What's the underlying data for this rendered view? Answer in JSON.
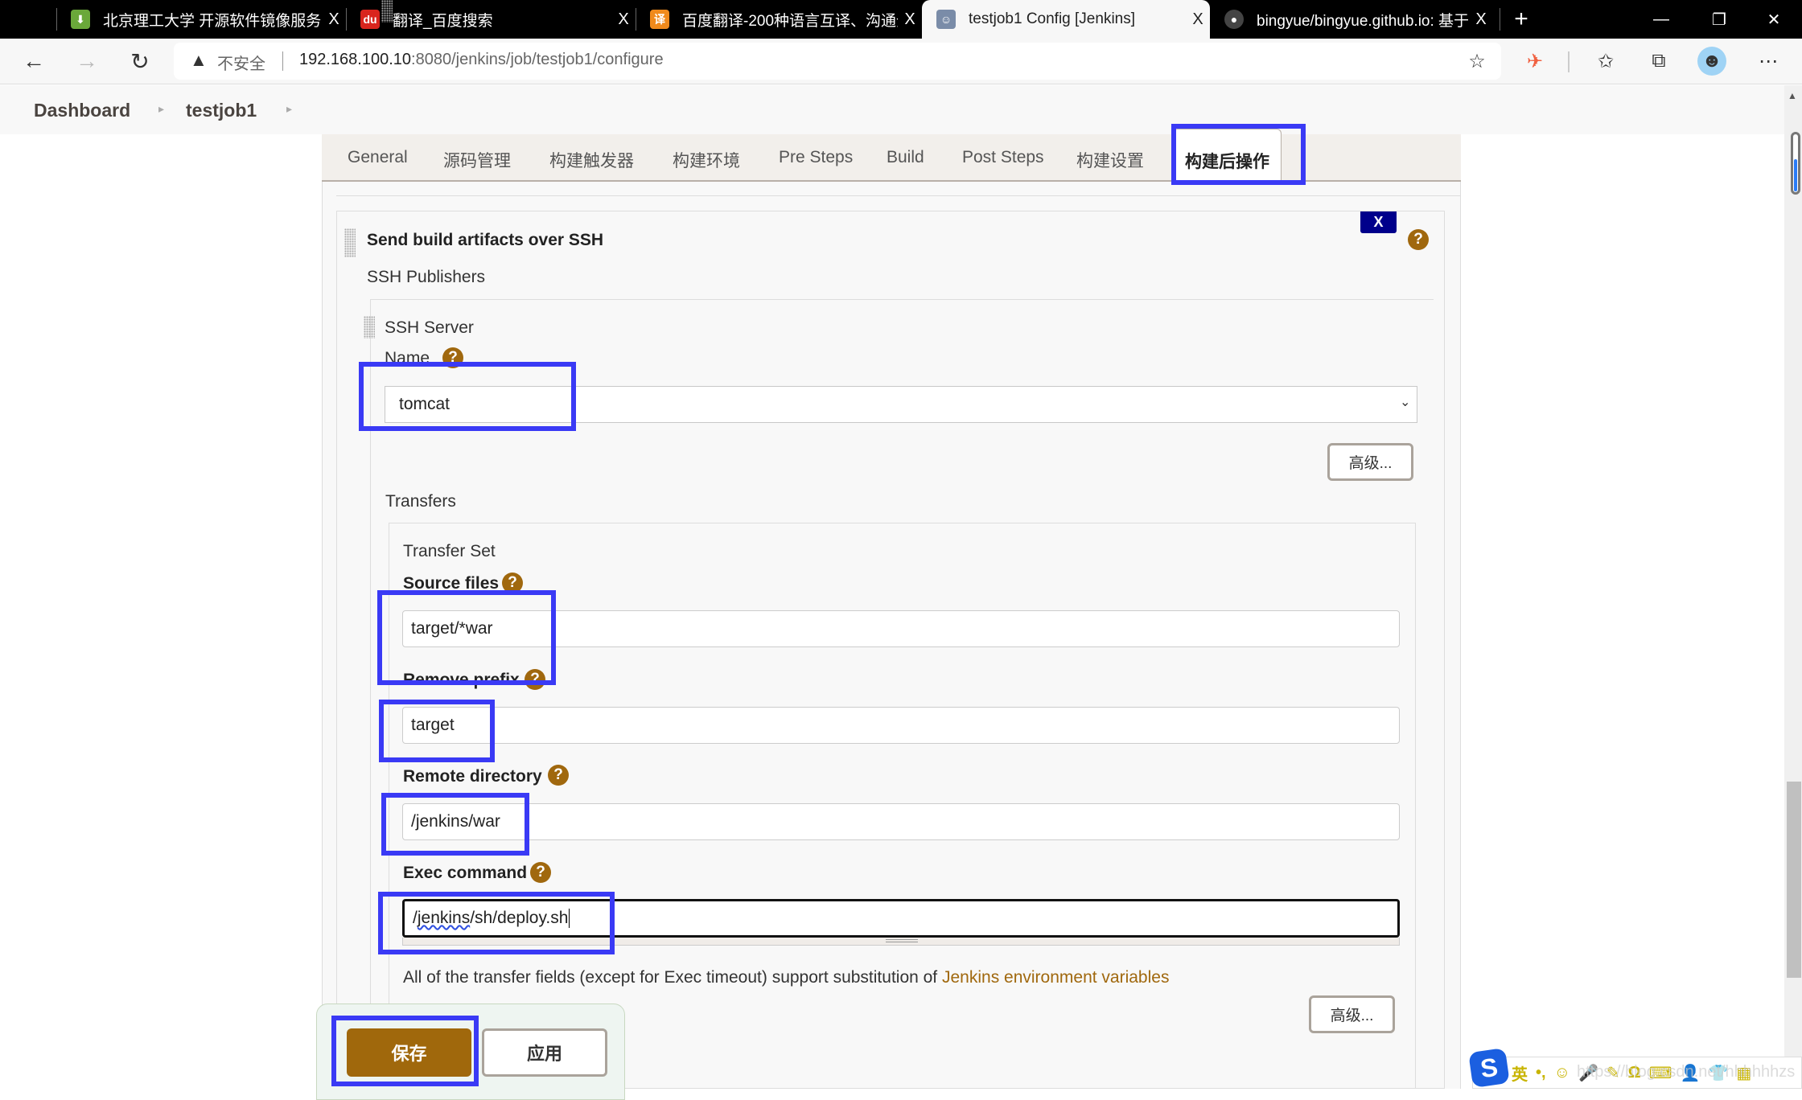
{
  "browser": {
    "tabs": [
      {
        "title": "北京理工大学 开源软件镜像服务",
        "favicon": "bit-mirror-icon",
        "color": "#6aa83a",
        "active": false
      },
      {
        "title": "翻译_百度搜索",
        "favicon": "baidu-paw-icon",
        "color": "#d9251d",
        "active": false
      },
      {
        "title": "百度翻译-200种语言互译、沟通全",
        "favicon": "baidu-translate-icon",
        "color": "#f08a1c",
        "active": false
      },
      {
        "title": "testjob1 Config [Jenkins]",
        "favicon": "jenkins-icon",
        "color": "#7a8ca8",
        "active": true
      },
      {
        "title": "bingyue/bingyue.github.io: 基于",
        "favicon": "github-icon",
        "color": "#444444",
        "active": false
      }
    ],
    "new_tab": "+",
    "close_glyph": "X",
    "window_controls": {
      "minimize": "—",
      "restore": "❐",
      "close": "✕"
    },
    "address": {
      "security_label": "不安全",
      "url_host": "192.168.100.10",
      "url_rest": ":8080/jenkins/job/testjob1/configure"
    }
  },
  "breadcrumb": [
    {
      "label": "Dashboard"
    },
    {
      "label": "testjob1"
    }
  ],
  "config_tabs": [
    {
      "label": "General"
    },
    {
      "label": "源码管理"
    },
    {
      "label": "构建触发器"
    },
    {
      "label": "构建环境"
    },
    {
      "label": "Pre Steps"
    },
    {
      "label": "Build"
    },
    {
      "label": "Post Steps"
    },
    {
      "label": "构建设置"
    },
    {
      "label": "构建后操作",
      "active": true
    }
  ],
  "section": {
    "title": "构建后操作",
    "publisher_title": "Send build artifacts over SSH",
    "delete_label": "X",
    "ssh_publishers_label": "SSH Publishers",
    "ssh_server_label": "SSH Server",
    "name_label": "Name",
    "name_value": "tomcat",
    "advanced_label": "高级...",
    "transfers_label": "Transfers",
    "transfer_set_label": "Transfer Set",
    "fields": {
      "source_files": {
        "label": "Source files",
        "value": "target/*war"
      },
      "remove_prefix": {
        "label": "Remove prefix",
        "value": "target"
      },
      "remote_directory": {
        "label": "Remote directory",
        "value": "/jenkins/war"
      },
      "exec_command": {
        "label": "Exec command",
        "value_underlined": "jenkins",
        "value_prefix": "/",
        "value_suffix": "/sh/deploy.sh"
      }
    },
    "env_note": "All of the transfer fields (except for Exec timeout) support substitution of ",
    "env_link": "Jenkins environment variables",
    "advanced2_label": "高级...",
    "help_glyph": "?"
  },
  "footer": {
    "save_label": "保存",
    "apply_label": "应用"
  },
  "ime": {
    "mode": "英",
    "items": [
      "•,",
      "☺",
      "🎤",
      "✎",
      "Ω",
      "⌨",
      "👤",
      "👕",
      "▦"
    ],
    "watermark": "https://blog.csdn.net/hhhhhhzs"
  }
}
